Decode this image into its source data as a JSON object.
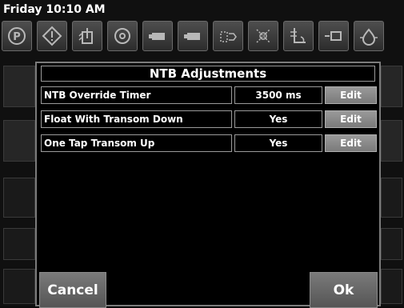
{
  "status": {
    "datetime": "Friday 10:10 AM"
  },
  "toolbar": {
    "icons": [
      {
        "name": "park-icon",
        "glyph": "P"
      },
      {
        "name": "warning-icon",
        "glyph": "!"
      },
      {
        "name": "engine-temp-icon",
        "glyph": ""
      },
      {
        "name": "oil-pressure-icon",
        "glyph": ""
      },
      {
        "name": "battery-icon",
        "glyph": ""
      },
      {
        "name": "battery-2-icon",
        "glyph": ""
      },
      {
        "name": "fuel-icon",
        "glyph": ""
      },
      {
        "name": "transmission-icon",
        "glyph": ""
      },
      {
        "name": "trim-icon",
        "glyph": ""
      },
      {
        "name": "coolant-icon",
        "glyph": ""
      },
      {
        "name": "drain-icon",
        "glyph": ""
      }
    ]
  },
  "dialog": {
    "title": "NTB Adjustments",
    "rows": [
      {
        "label": "NTB Override Timer",
        "value": "3500 ms",
        "edit": "Edit"
      },
      {
        "label": "Float With Transom Down",
        "value": "Yes",
        "edit": "Edit"
      },
      {
        "label": "One Tap Transom Up",
        "value": "Yes",
        "edit": "Edit"
      }
    ],
    "cancel_label": "Cancel",
    "ok_label": "Ok"
  }
}
